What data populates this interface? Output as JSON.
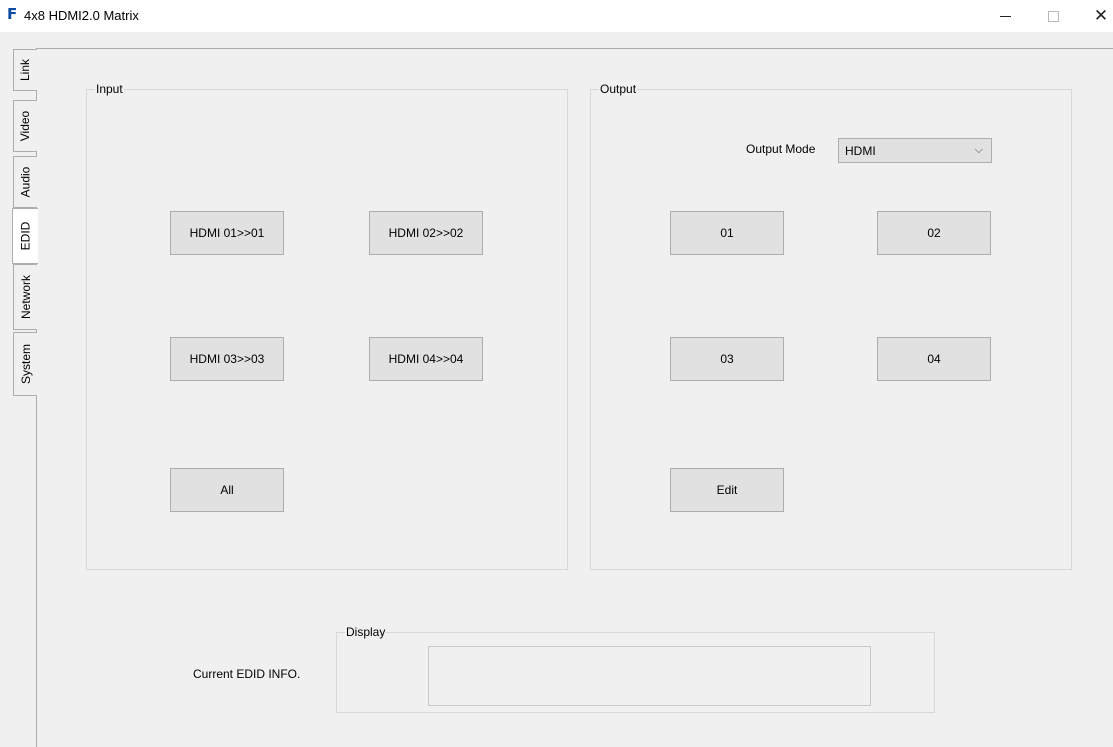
{
  "window": {
    "logo": "F",
    "title": "4x8 HDMI2.0 Matrix",
    "minimize": "",
    "maximize": "",
    "close": "✕"
  },
  "tabs": [
    {
      "label": "Link"
    },
    {
      "label": "Video"
    },
    {
      "label": "Audio"
    },
    {
      "label": "EDID",
      "active": true
    },
    {
      "label": "Network"
    },
    {
      "label": "System"
    }
  ],
  "input": {
    "title": "Input",
    "buttons": [
      "HDMI 01>>01",
      "HDMI 02>>02",
      "HDMI 03>>03",
      "HDMI 04>>04"
    ],
    "all_label": "All"
  },
  "output": {
    "title": "Output",
    "mode_label": "Output Mode",
    "mode_value": "HDMI",
    "buttons": [
      "01",
      "02",
      "03",
      "04"
    ],
    "edit_label": "Edit"
  },
  "display": {
    "title": "Display",
    "current_label": "Current EDID INFO.",
    "value": ""
  }
}
